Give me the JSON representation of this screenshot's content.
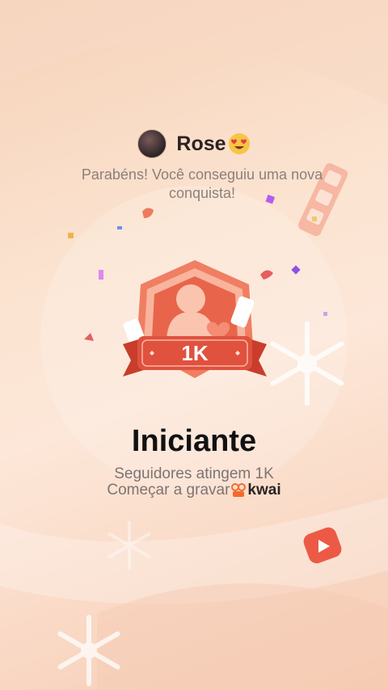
{
  "user": {
    "name": "Rose",
    "emoji": "heart-eyes-emoji"
  },
  "message": {
    "congrats": "Parabéns! Você conseguiu uma nova conquista!"
  },
  "badge": {
    "level_label": "1K",
    "icon": "person-badge-icon"
  },
  "achievement": {
    "title": "Iniciante",
    "description": "Seguidores atingem 1K",
    "start_recording": "Começar a gravar",
    "brand": "kwai"
  },
  "colors": {
    "badge_red": "#e0513e",
    "badge_light": "#f6a28e",
    "background": "#fbe3d0",
    "text_dark": "#111111",
    "text_muted": "#7e7371"
  }
}
